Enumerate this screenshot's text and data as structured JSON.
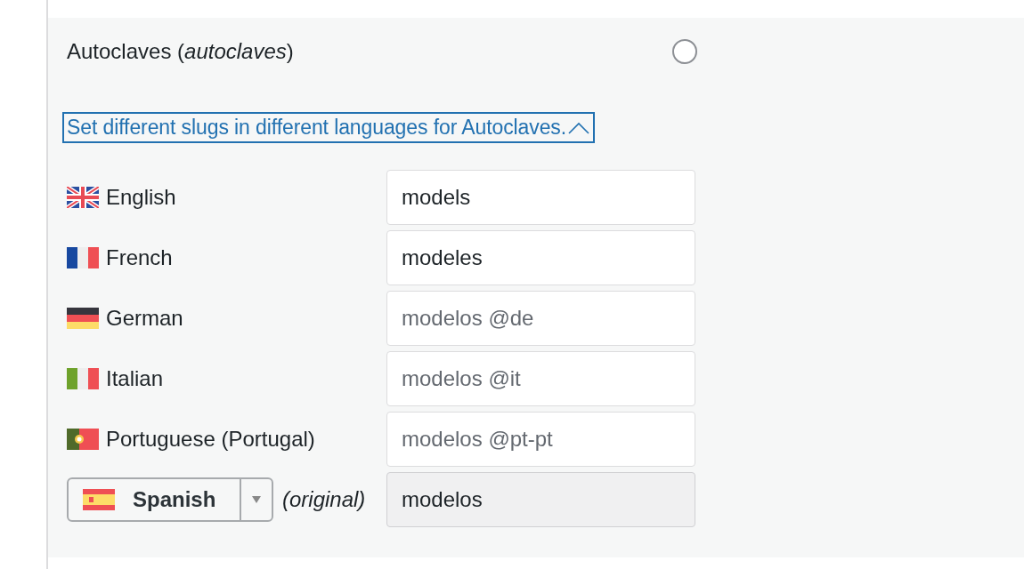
{
  "item": {
    "title": "Autoclaves (*autoclaves*)",
    "checked": false
  },
  "toggle_link": {
    "label": "Set different slugs in different languages for Autoclaves.",
    "expanded": true
  },
  "languages": [
    {
      "label": "English",
      "value": "models",
      "disabled": false
    },
    {
      "label": "French",
      "value": "modeles",
      "disabled": false
    },
    {
      "label": "German",
      "placeholder": "modelos @de",
      "disabled": false
    },
    {
      "label": "Italian",
      "placeholder": "modelos @it",
      "disabled": false
    },
    {
      "label": "Portuguese (Portugal)",
      "placeholder": "modelos @pt-pt",
      "disabled": false
    }
  ],
  "original": {
    "language": "Spanish",
    "note": "(original)",
    "value": "modelos",
    "disabled": true
  }
}
